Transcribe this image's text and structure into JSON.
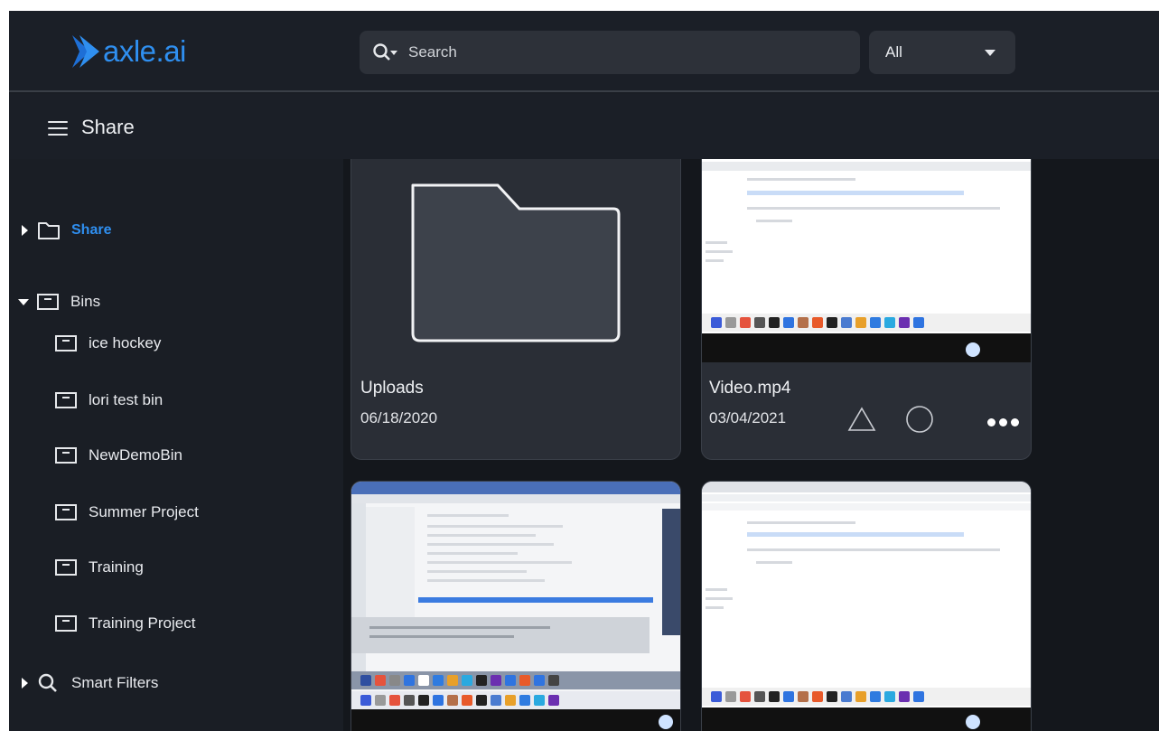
{
  "brand": {
    "name": "axle.ai",
    "accent": "#2f8ff0"
  },
  "search": {
    "placeholder": "Search",
    "icon": "search-icon",
    "filter_value": "All"
  },
  "header": {
    "title": "Share",
    "menu_icon": "hamburger-icon"
  },
  "sidebar": {
    "share_label": "Share",
    "bins_label": "Bins",
    "bins": [
      "ice hockey",
      "lori test bin",
      "NewDemoBin",
      "Summer Project",
      "Training",
      "Training Project"
    ],
    "smart_filters_label": "Smart Filters"
  },
  "cards": [
    {
      "name": "Uploads",
      "date": "06/18/2020",
      "kind": "folder"
    },
    {
      "name": "Video.mp4",
      "date": "03/04/2021",
      "kind": "video"
    },
    {
      "name": "",
      "date": "",
      "kind": "screenshot"
    },
    {
      "name": "",
      "date": "",
      "kind": "screenshot"
    }
  ]
}
